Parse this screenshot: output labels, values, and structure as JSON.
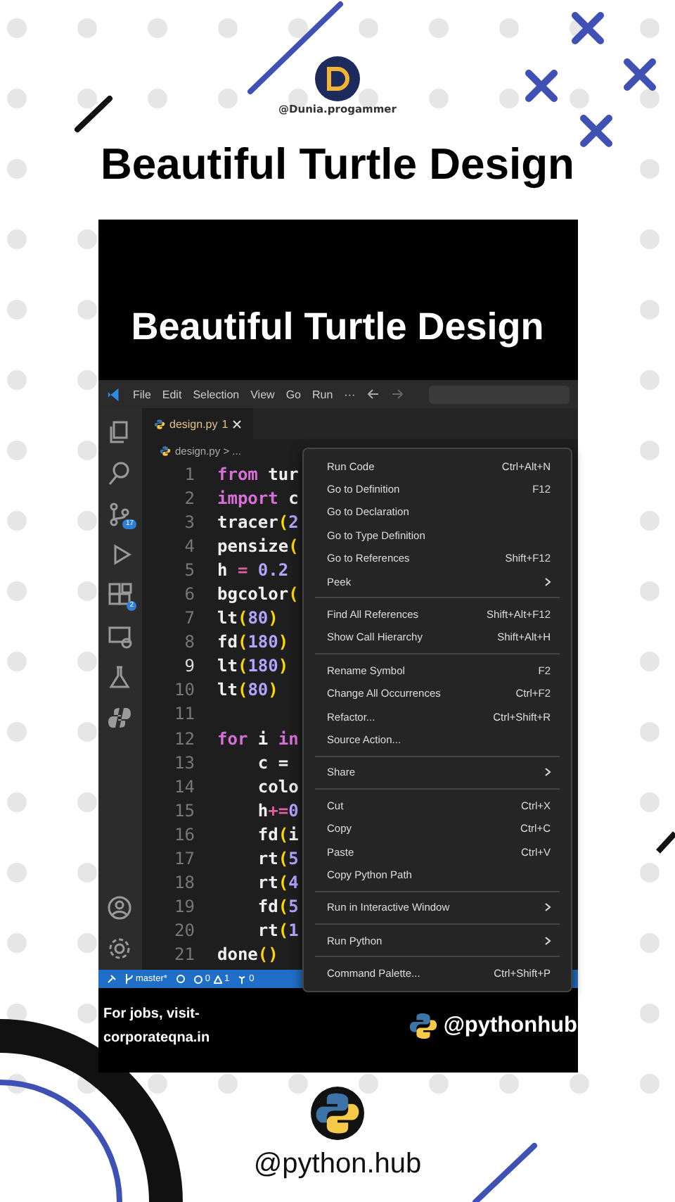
{
  "header": {
    "handle": "@Dunia.progammer",
    "title": "Beautiful Turtle Design"
  },
  "panel": {
    "title": "Beautiful Turtle Design",
    "editor": {
      "menu": [
        "File",
        "Edit",
        "Selection",
        "View",
        "Go",
        "Run",
        "···"
      ],
      "activity": [
        {
          "kind": "files"
        },
        {
          "kind": "search"
        },
        {
          "kind": "source-control",
          "badge": "17"
        },
        {
          "kind": "run"
        },
        {
          "kind": "extensions",
          "badge": "2"
        },
        {
          "kind": "remote"
        },
        {
          "kind": "testing"
        },
        {
          "kind": "python"
        }
      ],
      "activity_bottom": [
        {
          "kind": "account"
        },
        {
          "kind": "settings"
        }
      ],
      "tab": {
        "label": "design.py",
        "problems": "1"
      },
      "breadcrumb": "design.py > ...",
      "lines": [
        {
          "no": "1",
          "code": [
            {
              "kind": "kw",
              "text": "from"
            },
            {
              "kind": "plain",
              "text": " tur"
            }
          ]
        },
        {
          "no": "2",
          "code": [
            {
              "kind": "kw",
              "text": "import"
            },
            {
              "kind": "plain",
              "text": " c"
            }
          ]
        },
        {
          "no": "3",
          "code": [
            {
              "kind": "fn",
              "text": "tracer"
            },
            {
              "kind": "paren",
              "text": "("
            },
            {
              "kind": "num",
              "text": "2"
            }
          ]
        },
        {
          "no": "4",
          "code": [
            {
              "kind": "fn",
              "text": "pensize"
            },
            {
              "kind": "paren",
              "text": "("
            }
          ]
        },
        {
          "no": "5",
          "code": [
            {
              "kind": "plain",
              "text": "h "
            },
            {
              "kind": "op",
              "text": "="
            },
            {
              "kind": "num",
              "text": " 0.2"
            }
          ]
        },
        {
          "no": "6",
          "code": [
            {
              "kind": "fn",
              "text": "bgcolor"
            },
            {
              "kind": "paren",
              "text": "("
            }
          ]
        },
        {
          "no": "7",
          "code": [
            {
              "kind": "fn",
              "text": "lt"
            },
            {
              "kind": "paren",
              "text": "("
            },
            {
              "kind": "num",
              "text": "80"
            },
            {
              "kind": "paren",
              "text": ")"
            }
          ]
        },
        {
          "no": "8",
          "code": [
            {
              "kind": "fn",
              "text": "fd"
            },
            {
              "kind": "paren",
              "text": "("
            },
            {
              "kind": "num",
              "text": "180"
            },
            {
              "kind": "paren",
              "text": ")"
            }
          ]
        },
        {
          "no": "9",
          "code": [
            {
              "kind": "fn",
              "text": "lt"
            },
            {
              "kind": "paren",
              "text": "("
            },
            {
              "kind": "num",
              "text": "180"
            },
            {
              "kind": "paren",
              "text": ")"
            }
          ]
        },
        {
          "no": "10",
          "code": [
            {
              "kind": "fn",
              "text": "lt"
            },
            {
              "kind": "paren",
              "text": "("
            },
            {
              "kind": "num",
              "text": "80"
            },
            {
              "kind": "paren",
              "text": ")"
            }
          ]
        },
        {
          "no": "11"
        },
        {
          "no": "12",
          "code": [
            {
              "kind": "kw",
              "text": "for"
            },
            {
              "kind": "plain",
              "text": " i "
            },
            {
              "kind": "kw",
              "text": "in"
            }
          ]
        },
        {
          "no": "13",
          "code": [
            {
              "kind": "plain",
              "text": "    c = "
            }
          ]
        },
        {
          "no": "14",
          "code": [
            {
              "kind": "plain",
              "text": "    colo"
            }
          ]
        },
        {
          "no": "15",
          "code": [
            {
              "kind": "plain",
              "text": "    h"
            },
            {
              "kind": "op",
              "text": "+="
            },
            {
              "kind": "num",
              "text": "0"
            }
          ]
        },
        {
          "no": "16",
          "code": [
            {
              "kind": "fn",
              "text": "    fd"
            },
            {
              "kind": "paren",
              "text": "("
            },
            {
              "kind": "plain",
              "text": "i"
            }
          ]
        },
        {
          "no": "17",
          "code": [
            {
              "kind": "fn",
              "text": "    rt"
            },
            {
              "kind": "paren",
              "text": "("
            },
            {
              "kind": "num",
              "text": "5"
            }
          ]
        },
        {
          "no": "18",
          "code": [
            {
              "kind": "fn",
              "text": "    rt"
            },
            {
              "kind": "paren",
              "text": "("
            },
            {
              "kind": "num",
              "text": "4"
            }
          ]
        },
        {
          "no": "19",
          "code": [
            {
              "kind": "fn",
              "text": "    fd"
            },
            {
              "kind": "paren",
              "text": "("
            },
            {
              "kind": "num",
              "text": "5"
            }
          ]
        },
        {
          "no": "20",
          "code": [
            {
              "kind": "fn",
              "text": "    rt"
            },
            {
              "kind": "paren",
              "text": "("
            },
            {
              "kind": "num",
              "text": "1"
            }
          ]
        },
        {
          "no": "21",
          "code": [
            {
              "kind": "fn",
              "text": "done"
            },
            {
              "kind": "paren",
              "text": "()"
            }
          ]
        }
      ],
      "context_menu": [
        {
          "kind": "item",
          "label": "Run Code",
          "shortcut": "Ctrl+Alt+N"
        },
        {
          "kind": "item",
          "label": "Go to Definition",
          "shortcut": "F12"
        },
        {
          "kind": "item",
          "label": "Go to Declaration"
        },
        {
          "kind": "item",
          "label": "Go to Type Definition"
        },
        {
          "kind": "item",
          "label": "Go to References",
          "shortcut": "Shift+F12"
        },
        {
          "kind": "submenu",
          "label": "Peek"
        },
        {
          "kind": "separator"
        },
        {
          "kind": "item",
          "label": "Find All References",
          "shortcut": "Shift+Alt+F12"
        },
        {
          "kind": "item",
          "label": "Show Call Hierarchy",
          "shortcut": "Shift+Alt+H"
        },
        {
          "kind": "separator"
        },
        {
          "kind": "item",
          "label": "Rename Symbol",
          "shortcut": "F2"
        },
        {
          "kind": "item",
          "label": "Change All Occurrences",
          "shortcut": "Ctrl+F2"
        },
        {
          "kind": "item",
          "label": "Refactor...",
          "shortcut": "Ctrl+Shift+R"
        },
        {
          "kind": "item",
          "label": "Source Action..."
        },
        {
          "kind": "separator"
        },
        {
          "kind": "submenu",
          "label": "Share"
        },
        {
          "kind": "separator"
        },
        {
          "kind": "item",
          "label": "Cut",
          "shortcut": "Ctrl+X"
        },
        {
          "kind": "item",
          "label": "Copy",
          "shortcut": "Ctrl+C"
        },
        {
          "kind": "item",
          "label": "Paste",
          "shortcut": "Ctrl+V"
        },
        {
          "kind": "item",
          "label": "Copy Python Path"
        },
        {
          "kind": "separator"
        },
        {
          "kind": "submenu",
          "label": "Run in Interactive Window"
        },
        {
          "kind": "separator"
        },
        {
          "kind": "submenu",
          "label": "Run Python"
        },
        {
          "kind": "separator"
        },
        {
          "kind": "item",
          "label": "Command Palette...",
          "shortcut": "Ctrl+Shift+P"
        }
      ],
      "status": {
        "branch": "master*",
        "errors": "0",
        "warnings": "1",
        "ports": "0"
      }
    },
    "footer": {
      "note": "For jobs, visit-\ncorporateqna.in",
      "handle": "@pythonhub"
    }
  },
  "bottom": {
    "handle": "@python.hub"
  }
}
